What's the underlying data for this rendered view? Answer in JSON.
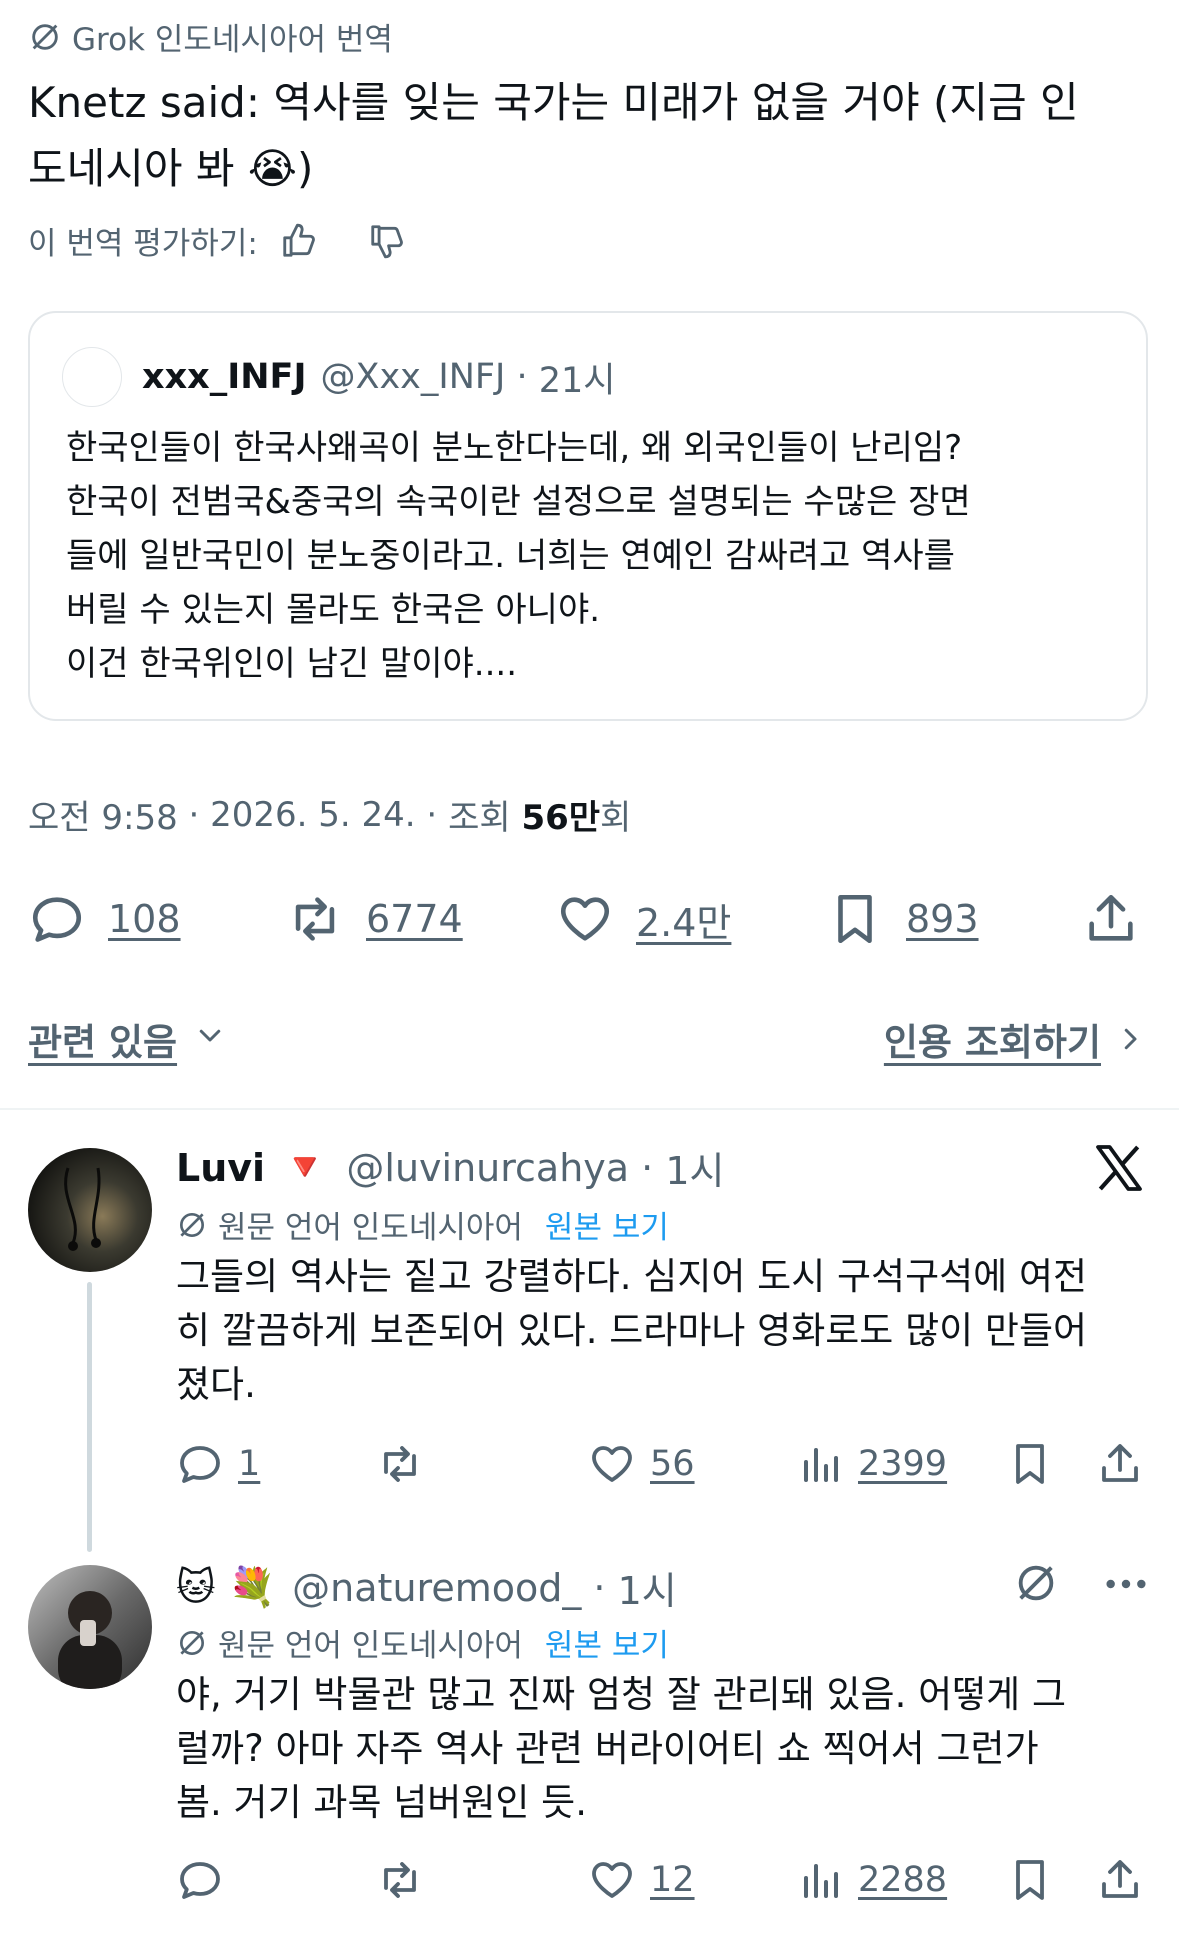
{
  "translation": {
    "label": "Grok 인도네시아어 번역",
    "text_line1": "Knetz said: 역사를 잊는 국가는 미래가 없을 거야 (지금 인",
    "text_line2": "도네시아 봐 😭)",
    "rate_label": "이 번역 평가하기:"
  },
  "quoted": {
    "name": "xxx_INFJ",
    "handle": "@Xxx_INFJ",
    "time": "21시",
    "body": "한국인들이 한국사왜곡이 분노한다는데, 왜 외국인들이 난리임?\n한국이 전범국&중국의 속국이란 설정으로 설명되는 수많은 장면\n들에 일반국민이 분노중이라고. 너희는 연예인 감싸려고 역사를\n버릴 수 있는지 몰라도 한국은 아니야.\n이건 한국위인이 남긴 말이야...."
  },
  "meta": {
    "time": "오전 9:58",
    "date": "2026. 5. 24.",
    "views_label": "조회",
    "views_value": "56만",
    "views_suffix": "회"
  },
  "stats": {
    "replies": "108",
    "reposts": "6774",
    "likes": "2.4만",
    "bookmarks": "893"
  },
  "related": {
    "label": "관련 있음",
    "quotes": "인용 조회하기"
  },
  "replies": [
    {
      "name": "Luvi",
      "badge": "🔻",
      "handle": "@luvinurcahya",
      "time": "1시",
      "source_label": "원문 언어 인도네시아어",
      "show_original": "원본 보기",
      "body": "그들의 역사는 짙고 강렬하다. 심지어 도시 구석구석에 여전\n히 깔끔하게 보존되어 있다. 드라마나 영화로도 많이 만들어\n졌다.",
      "replies": "1",
      "likes": "56",
      "views": "2399"
    },
    {
      "name": "🐱 💐",
      "handle": "@naturemood_",
      "time": "1시",
      "source_label": "원문 언어 인도네시아어",
      "show_original": "원본 보기",
      "body": "야, 거기 박물관 많고 진짜 엄청 잘 관리돼 있음. 어떻게 그\n럴까? 아마 자주 역사 관련 버라이어티 쇼 찍어서 그런가\n봄. 거기 과목 넘버원인 듯.",
      "likes": "12",
      "views": "2288"
    }
  ],
  "colors": {
    "text": "#0f1419",
    "muted": "#536471",
    "link": "#1d9bf0",
    "border": "#e3e7ea"
  }
}
